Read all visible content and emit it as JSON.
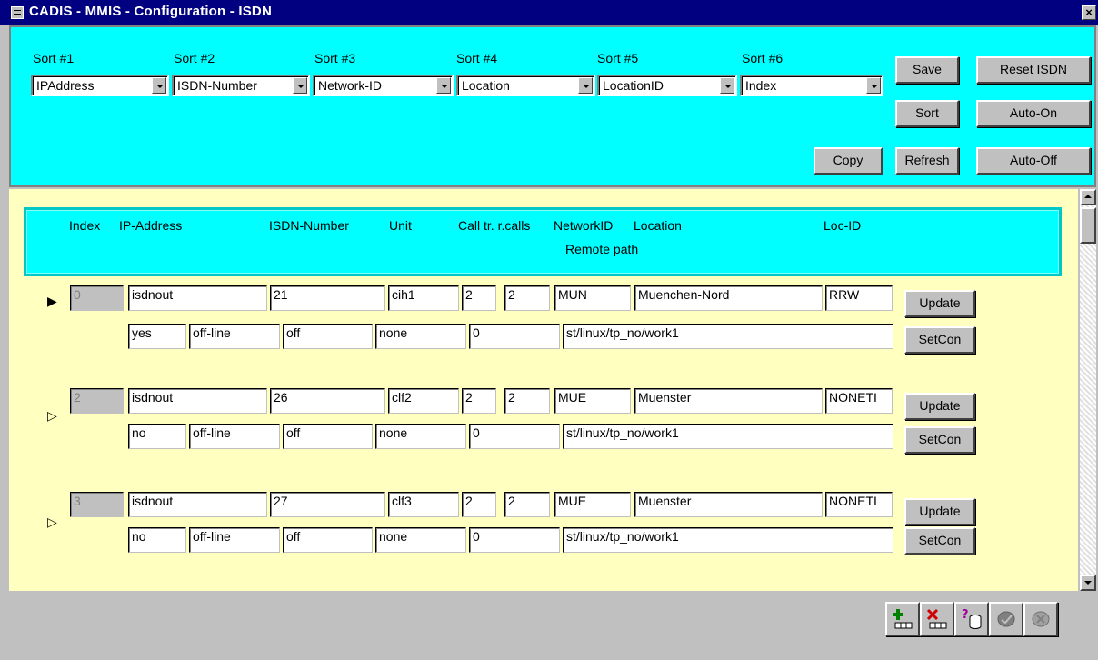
{
  "window": {
    "title": "CADIS - MMIS - Configuration - ISDN",
    "close_label": "×"
  },
  "sort": [
    {
      "label": "Sort #1",
      "value": "IPAddress"
    },
    {
      "label": "Sort #2",
      "value": "ISDN-Number"
    },
    {
      "label": "Sort #3",
      "value": "Network-ID"
    },
    {
      "label": "Sort #4",
      "value": "Location"
    },
    {
      "label": "Sort #5",
      "value": "LocationID"
    },
    {
      "label": "Sort #6",
      "value": "Index"
    }
  ],
  "buttons": {
    "save": "Save",
    "reset_isdn": "Reset ISDN",
    "sort": "Sort",
    "auto_on": "Auto-On",
    "copy": "Copy",
    "refresh": "Refresh",
    "auto_off": "Auto-Off"
  },
  "columns": {
    "index": "Index",
    "ip_address": "IP-Address",
    "isdn_number": "ISDN-Number",
    "unit": "Unit",
    "call_tr_rcalls": "Call tr. r.calls",
    "network_id": "NetworkID",
    "location": "Location",
    "loc_id": "Loc-ID",
    "remote_path": "Remote path"
  },
  "records": [
    {
      "marker": "▶",
      "index": "0",
      "ip_address": "isdnout",
      "isdn_number": "21",
      "unit": "cih1",
      "call_tr": "2",
      "r_calls": "2",
      "network_id": "MUN",
      "location": "Muenchen-Nord",
      "loc_id": "RRW",
      "f1": "yes",
      "f2": "off-line",
      "f3": "off",
      "f4": "none",
      "f5": "0",
      "remote_path": "st/linux/tp_no/work1",
      "update": "Update",
      "setcon": "SetCon"
    },
    {
      "marker": "▷",
      "index": "2",
      "ip_address": "isdnout",
      "isdn_number": "26",
      "unit": "clf2",
      "call_tr": "2",
      "r_calls": "2",
      "network_id": "MUE",
      "location": "Muenster",
      "loc_id": "NONETI",
      "f1": "no",
      "f2": "off-line",
      "f3": "off",
      "f4": "none",
      "f5": "0",
      "remote_path": "st/linux/tp_no/work1",
      "update": "Update",
      "setcon": "SetCon"
    },
    {
      "marker": "▷",
      "index": "3",
      "ip_address": "isdnout",
      "isdn_number": "27",
      "unit": "clf3",
      "call_tr": "2",
      "r_calls": "2",
      "network_id": "MUE",
      "location": "Muenster",
      "loc_id": "NONETI",
      "f1": "no",
      "f2": "off-line",
      "f3": "off",
      "f4": "none",
      "f5": "0",
      "remote_path": "st/linux/tp_no/work1",
      "update": "Update",
      "setcon": "SetCon"
    }
  ],
  "navigator": [
    "add-record-icon",
    "delete-record-icon",
    "query-database-icon",
    "post-icon",
    "cancel-icon"
  ]
}
